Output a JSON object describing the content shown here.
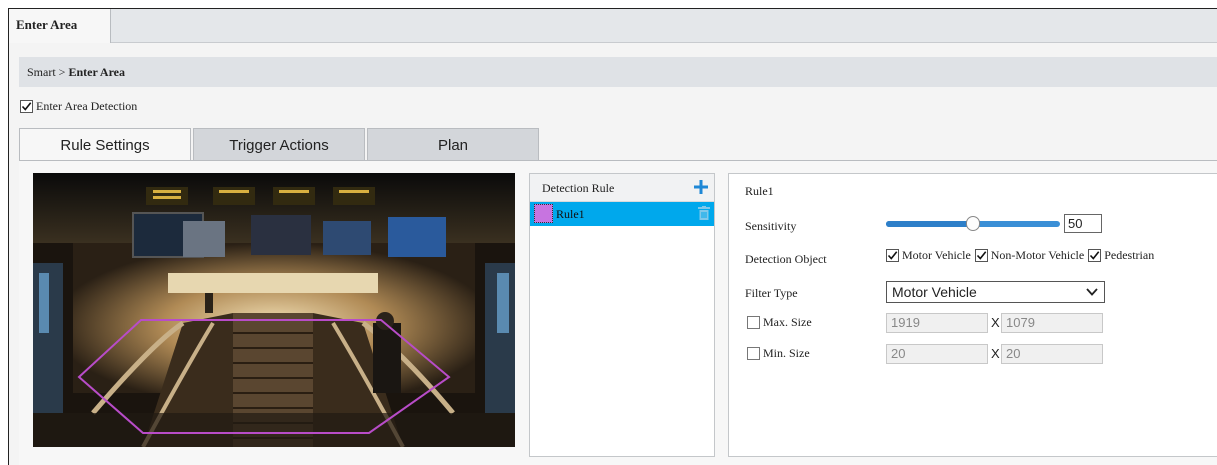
{
  "page_tab": {
    "label": "Enter Area"
  },
  "breadcrumb": {
    "parent": "Smart",
    "separator": ">",
    "current": "Enter Area"
  },
  "enable": {
    "label": "Enter Area Detection",
    "checked": true
  },
  "tabs": [
    {
      "label": "Rule Settings",
      "active": true
    },
    {
      "label": "Trigger Actions",
      "active": false
    },
    {
      "label": "Plan",
      "active": false
    }
  ],
  "rule_list": {
    "header": "Detection Rule",
    "items": [
      {
        "name": "Rule1",
        "color": "#c774e0",
        "selected": true
      }
    ],
    "selected_color": "#00a8ec"
  },
  "detail": {
    "title": "Rule1",
    "sensitivity": {
      "label": "Sensitivity",
      "value": "50",
      "fraction": 0.5
    },
    "detection_object": {
      "label": "Detection Object",
      "options": [
        {
          "label": "Motor Vehicle",
          "checked": true
        },
        {
          "label": "Non-Motor Vehicle",
          "checked": true
        },
        {
          "label": "Pedestrian",
          "checked": true
        }
      ]
    },
    "filter_type": {
      "label": "Filter Type",
      "value": "Motor Vehicle"
    },
    "max_size": {
      "label": "Max. Size",
      "checked": false,
      "width": "1919",
      "sep": "X",
      "height": "1079"
    },
    "min_size": {
      "label": "Min. Size",
      "checked": false,
      "width": "20",
      "sep": "X",
      "height": "20"
    }
  },
  "colors": {
    "accent": "#2d7fc9",
    "add_icon": "#1e88d6",
    "polygon": "#b84cc8"
  }
}
